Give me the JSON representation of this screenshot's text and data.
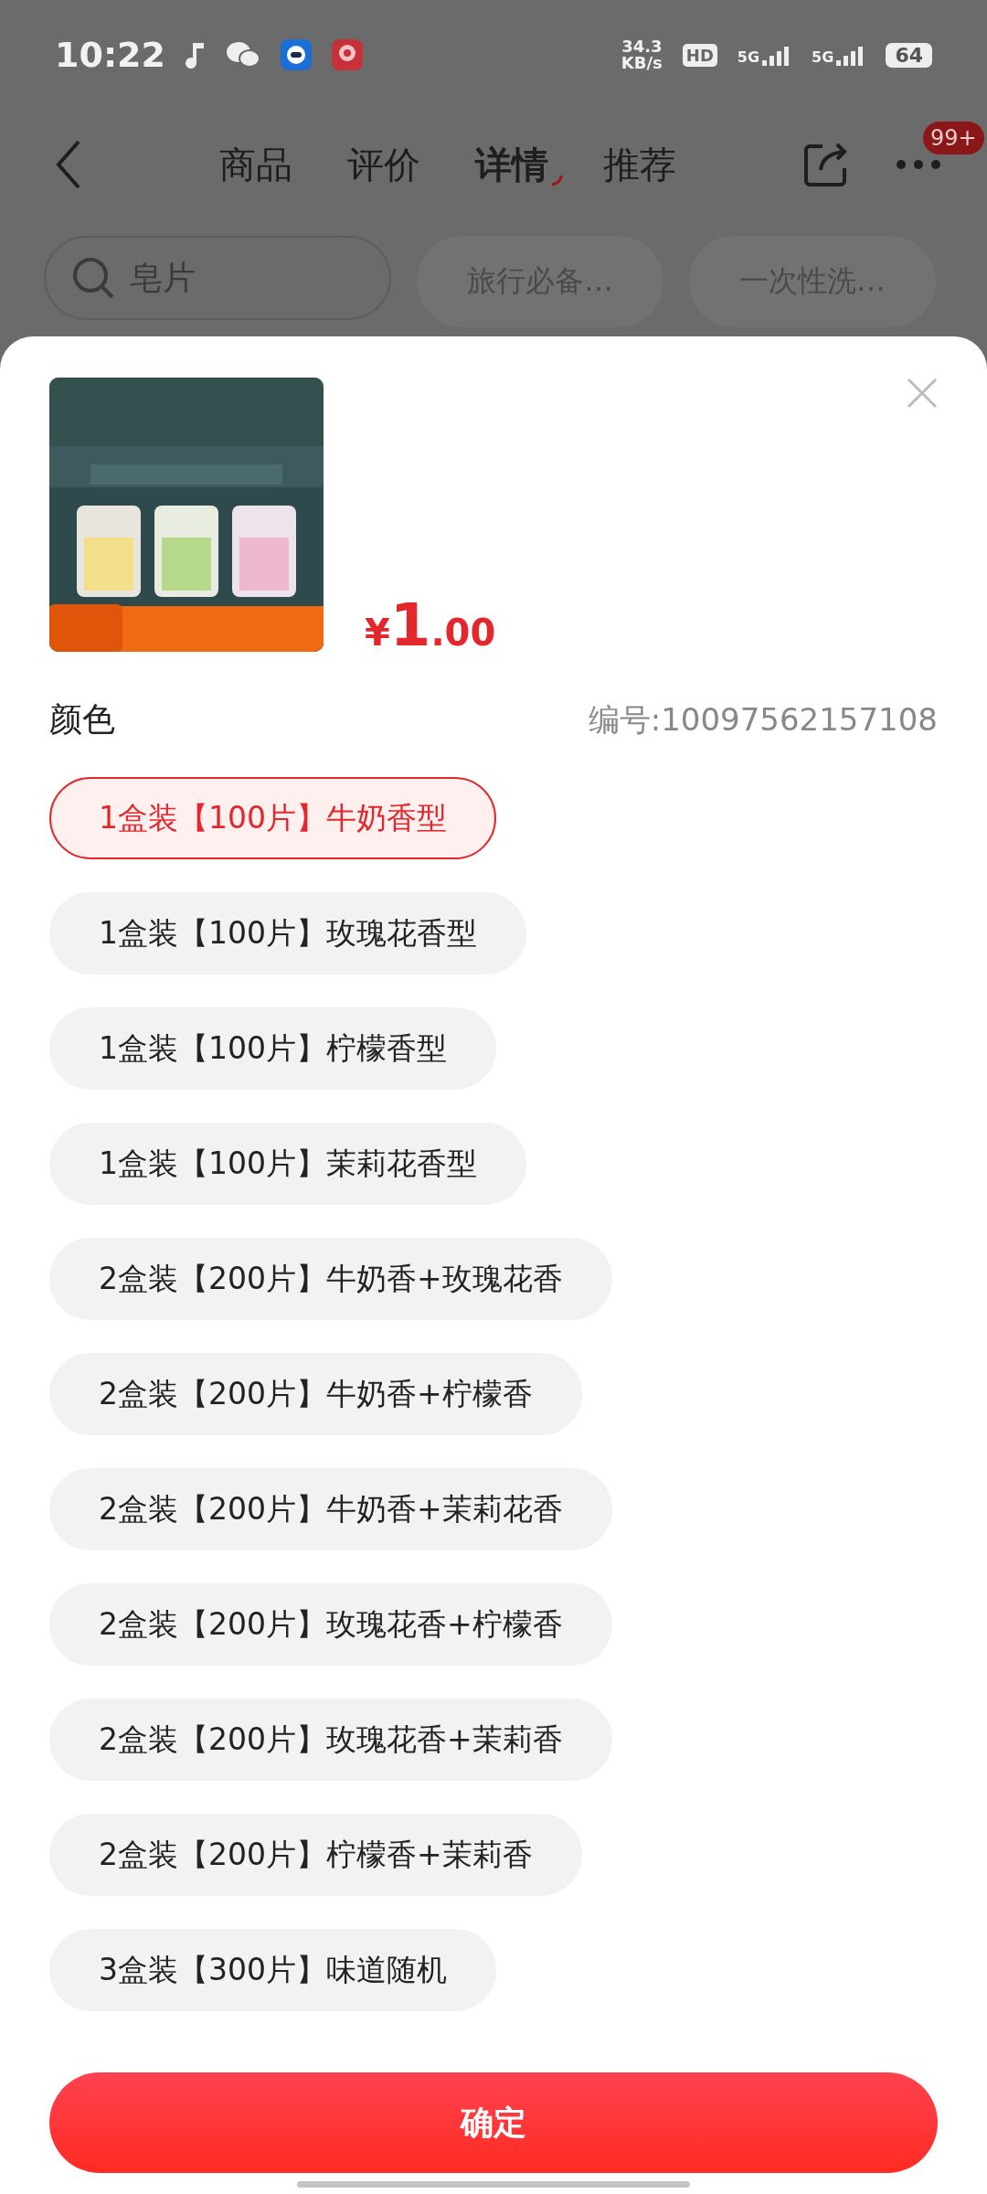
{
  "status_bar": {
    "time": "10:22",
    "speed": "34.3",
    "speed_unit": "KB/s",
    "hd": "HD",
    "net1": "5G",
    "net2": "5G",
    "battery": "64"
  },
  "header": {
    "tabs": [
      {
        "label": "商品",
        "selected": false
      },
      {
        "label": "评价",
        "selected": false
      },
      {
        "label": "详情",
        "selected": true
      },
      {
        "label": "推荐",
        "selected": false
      }
    ],
    "badge": "99+"
  },
  "search": {
    "value": "皂片",
    "chips": [
      "旅行必备…",
      "一次性洗…"
    ]
  },
  "sheet": {
    "price": {
      "symbol": "¥",
      "integer": "1",
      "decimal": ".00"
    },
    "group_label": "颜色",
    "sku": "编号:10097562157108",
    "options": [
      {
        "label": "1盒装【100片】牛奶香型",
        "selected": true
      },
      {
        "label": "1盒装【100片】玫瑰花香型",
        "selected": false
      },
      {
        "label": "1盒装【100片】柠檬香型",
        "selected": false
      },
      {
        "label": "1盒装【100片】茉莉花香型",
        "selected": false
      },
      {
        "label": "2盒装【200片】牛奶香+玫瑰花香",
        "selected": false
      },
      {
        "label": "2盒装【200片】牛奶香+柠檬香",
        "selected": false
      },
      {
        "label": "2盒装【200片】牛奶香+茉莉花香",
        "selected": false
      },
      {
        "label": "2盒装【200片】玫瑰花香+柠檬香",
        "selected": false
      },
      {
        "label": "2盒装【200片】玫瑰花香+茉莉香",
        "selected": false
      },
      {
        "label": "2盒装【200片】柠檬香+茉莉香",
        "selected": false
      },
      {
        "label": "3盒装【300片】味道随机",
        "selected": false
      }
    ],
    "confirm": "确定"
  }
}
